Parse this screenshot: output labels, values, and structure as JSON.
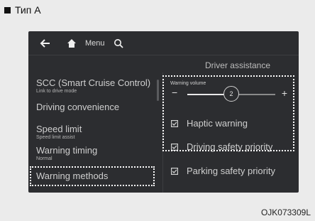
{
  "variant_label": "Тип А",
  "topbar": {
    "back_icon": "back-arrow-icon",
    "home_icon": "home-icon",
    "menu_label": "Menu",
    "search_icon": "search-icon"
  },
  "header": {
    "title": "Driver assistance"
  },
  "menu_items": [
    {
      "label": "SCC (Smart Cruise Control)",
      "sub": "Link to drive mode",
      "selected": false
    },
    {
      "label": "Driving convenience",
      "sub": "",
      "selected": false
    },
    {
      "label": "Speed limit",
      "sub": "Speed limit assist",
      "selected": false
    },
    {
      "label": "Warning timing",
      "sub": "Normal",
      "selected": false
    },
    {
      "label": "Warning methods",
      "sub": "",
      "selected": true
    }
  ],
  "right_panel": {
    "warning_volume": {
      "label": "Warning volume",
      "minus": "−",
      "plus": "+",
      "value": "2",
      "level_fraction": 0.5
    },
    "options": [
      {
        "label": "Haptic warning",
        "checked": true
      },
      {
        "label": "Driving safety priority",
        "checked": true
      },
      {
        "label": "Parking safety priority",
        "checked": true
      }
    ]
  },
  "figure_code": "OJK073309L",
  "colors": {
    "screen_bg": "#2c2d30",
    "text": "#cfcfcf",
    "highlight": "#ffffff"
  }
}
